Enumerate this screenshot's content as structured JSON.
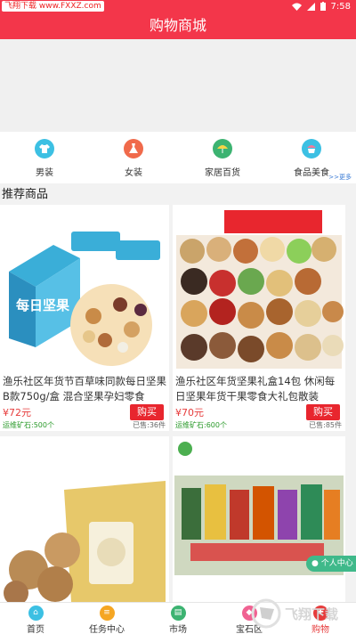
{
  "status_bar": {
    "watermark": "飞翔下载 www.FXXZ.com",
    "time": "7:58"
  },
  "app_bar": {
    "title": "购物商城"
  },
  "categories": [
    {
      "label": "男装",
      "icon": "shirt-icon",
      "color": "#3cc0e3"
    },
    {
      "label": "女装",
      "icon": "dress-icon",
      "color": "#f06a4b"
    },
    {
      "label": "家居百货",
      "icon": "umbrella-icon",
      "color": "#3cb371"
    },
    {
      "label": "食品美食",
      "icon": "cupcake-icon",
      "color": "#3cc0e3"
    }
  ],
  "more_link": ">>更多",
  "section_title": "推荐商品",
  "products": [
    {
      "title": "渔乐社区年货节百草味同款每日坚果B款750g/盒 混合坚果孕妇零食",
      "price": "¥72元",
      "buy_label": "购买",
      "mine": "运维矿石:500个",
      "sold": "已售:36件",
      "image_label": "每日坚果"
    },
    {
      "title": "渔乐社区年货坚果礼盒14包 休闲每日坚果年货干果零食大礼包散装",
      "price": "¥70元",
      "buy_label": "购买",
      "mine": "运维矿石:600个",
      "sold": "已售:85件",
      "image_label": ""
    },
    {
      "title": "",
      "price": "",
      "buy_label": "",
      "mine": "",
      "sold": "",
      "image_label": ""
    },
    {
      "title": "",
      "price": "",
      "buy_label": "",
      "mine": "",
      "sold": "",
      "image_label": ""
    }
  ],
  "float_button": "个人中心",
  "tabs": [
    {
      "label": "首页",
      "icon": "home-icon",
      "color": "#3cc0e3"
    },
    {
      "label": "任务中心",
      "icon": "task-icon",
      "color": "#f5a623"
    },
    {
      "label": "市场",
      "icon": "market-icon",
      "color": "#3cb371"
    },
    {
      "label": "宝石区",
      "icon": "gem-icon",
      "color": "#f06292"
    },
    {
      "label": "购物",
      "icon": "shop-icon",
      "color": "#e63c3c"
    }
  ],
  "watermark_logo": "飞翔下载"
}
